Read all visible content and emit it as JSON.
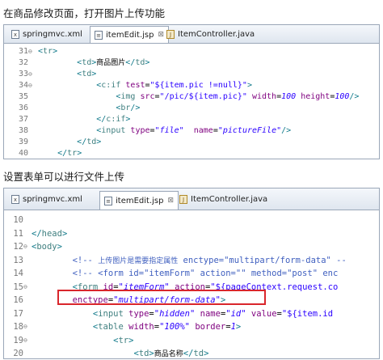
{
  "captions": {
    "top": "在商品修改页面，打开图片上传功能",
    "bottom": "设置表单可以进行文件上传"
  },
  "panel1": {
    "tabs": [
      {
        "label": "springmvc.xml",
        "icon": "xml-file-icon"
      },
      {
        "label": "itemEdit.jsp",
        "icon": "jsp-file-icon",
        "close": "⊠"
      },
      {
        "label": "ItemController.java",
        "icon": "java-file-icon"
      }
    ],
    "lines": [
      {
        "num": "31",
        "fold": "⊖",
        "html": "<span class='tag'>&lt;</span><span class='el'>tr</span><span class='tag'>&gt;</span>"
      },
      {
        "num": "32",
        "fold": "",
        "html": "        <span class='tag'>&lt;</span><span class='el'>td</span><span class='tag'>&gt;</span><span class='pl cn'>商品图片</span><span class='tag'>&lt;/</span><span class='el'>td</span><span class='tag'>&gt;</span>"
      },
      {
        "num": "33",
        "fold": "⊖",
        "html": "        <span class='tag'>&lt;</span><span class='el'>td</span><span class='tag'>&gt;</span>"
      },
      {
        "num": "34",
        "fold": "⊖",
        "html": "            <span class='tag'>&lt;</span><span class='el'>c:if</span> <span class='attr'>test</span>=<span class='str' style='font-style:normal'>\"${item.pic !=null}\"</span><span class='tag'>&gt;</span>"
      },
      {
        "num": "35",
        "fold": "",
        "html": "                <span class='tag'>&lt;</span><span class='el'>img</span> <span class='attr'>src</span>=<span class='str' style='font-style:normal'>\"/pic/${item.pic}\"</span> <span class='attr'>width</span>=<span class='str'>100</span> <span class='attr'>height</span>=<span class='str'>100</span><span class='tag'>/&gt;</span>"
      },
      {
        "num": "36",
        "fold": "",
        "html": "                <span class='tag'>&lt;</span><span class='el'>br</span><span class='tag'>/&gt;</span>"
      },
      {
        "num": "37",
        "fold": "",
        "html": "            <span class='tag'>&lt;/</span><span class='el'>c:if</span><span class='tag'>&gt;</span>"
      },
      {
        "num": "38",
        "fold": "",
        "html": "            <span class='tag'>&lt;</span><span class='el'>input</span> <span class='attr'>type</span>=<span class='str'>\"file\"</span>  <span class='attr'>name</span>=<span class='str'>\"pictureFile\"</span><span class='tag'>/&gt;</span>"
      },
      {
        "num": "39",
        "fold": "",
        "html": "        <span class='tag'>&lt;/</span><span class='el'>td</span><span class='tag'>&gt;</span>"
      },
      {
        "num": "40",
        "fold": "",
        "html": "    <span class='tag'>&lt;/</span><span class='el'>tr</span><span class='tag'>&gt;</span>"
      }
    ]
  },
  "panel2": {
    "tabs": [
      {
        "label": "springmvc.xml",
        "icon": "xml-file-icon"
      },
      {
        "label": "itemEdit.jsp",
        "icon": "jsp-file-icon",
        "close": "⊠"
      },
      {
        "label": "ItemController.java",
        "icon": "java-file-icon"
      }
    ],
    "lines": [
      {
        "num": "10",
        "fold": "",
        "html": ""
      },
      {
        "num": "11",
        "fold": "",
        "html": "<span class='tag'>&lt;/</span><span class='el'>head</span><span class='tag'>&gt;</span>"
      },
      {
        "num": "12",
        "fold": "⊖",
        "html": "<span class='tag'>&lt;</span><span class='el'>body</span><span class='tag'>&gt;</span>"
      },
      {
        "num": "13",
        "fold": "",
        "html": "        <span class='cm'>&lt;!-- <span class='cn'>上传图片是需要指定属性</span> enctype=\"multipart/form-data\" --</span>"
      },
      {
        "num": "14",
        "fold": "",
        "html": "        <span class='cm'>&lt;!-- &lt;form id=\"itemForm\" action=\"\" method=\"post\" enc</span>"
      },
      {
        "num": "15",
        "fold": "⊖",
        "html": "        <span class='tag'>&lt;</span><span class='el'>form</span> <span class='attr'>id</span>=<span class='str'>\"itemForm\"</span> <span class='attr'>action</span>=<span class='str' style='font-style:normal'>\"${pageContext.request.co</span>"
      },
      {
        "num": "16",
        "fold": "",
        "html": "        <span class='attr'>enctype</span>=<span class='str'>\"multipart/form-data\"</span><span class='tag'>&gt;</span>"
      },
      {
        "num": "17",
        "fold": "",
        "html": "            <span class='tag'>&lt;</span><span class='el'>input</span> <span class='attr'>type</span>=<span class='str'>\"hidden\"</span> <span class='attr'>name</span>=<span class='str'>\"id\"</span> <span class='attr'>value</span>=<span class='str' style='font-style:normal'>\"${item.id</span>"
      },
      {
        "num": "18",
        "fold": "⊖",
        "html": "            <span class='tag'>&lt;</span><span class='el'>table</span> <span class='attr'>width</span>=<span class='str'>\"100%\"</span> <span class='attr'>border</span>=<span class='str'>1</span><span class='tag'>&gt;</span>"
      },
      {
        "num": "19",
        "fold": "⊖",
        "html": "                <span class='tag'>&lt;</span><span class='el'>tr</span><span class='tag'>&gt;</span>"
      },
      {
        "num": "20",
        "fold": "",
        "html": "                    <span class='tag'>&lt;</span><span class='el'>td</span><span class='tag'>&gt;</span><span class='pl cn'>商品名称</span><span class='tag'>&lt;/</span><span class='el'>td</span><span class='tag'>&gt;</span>"
      }
    ]
  }
}
